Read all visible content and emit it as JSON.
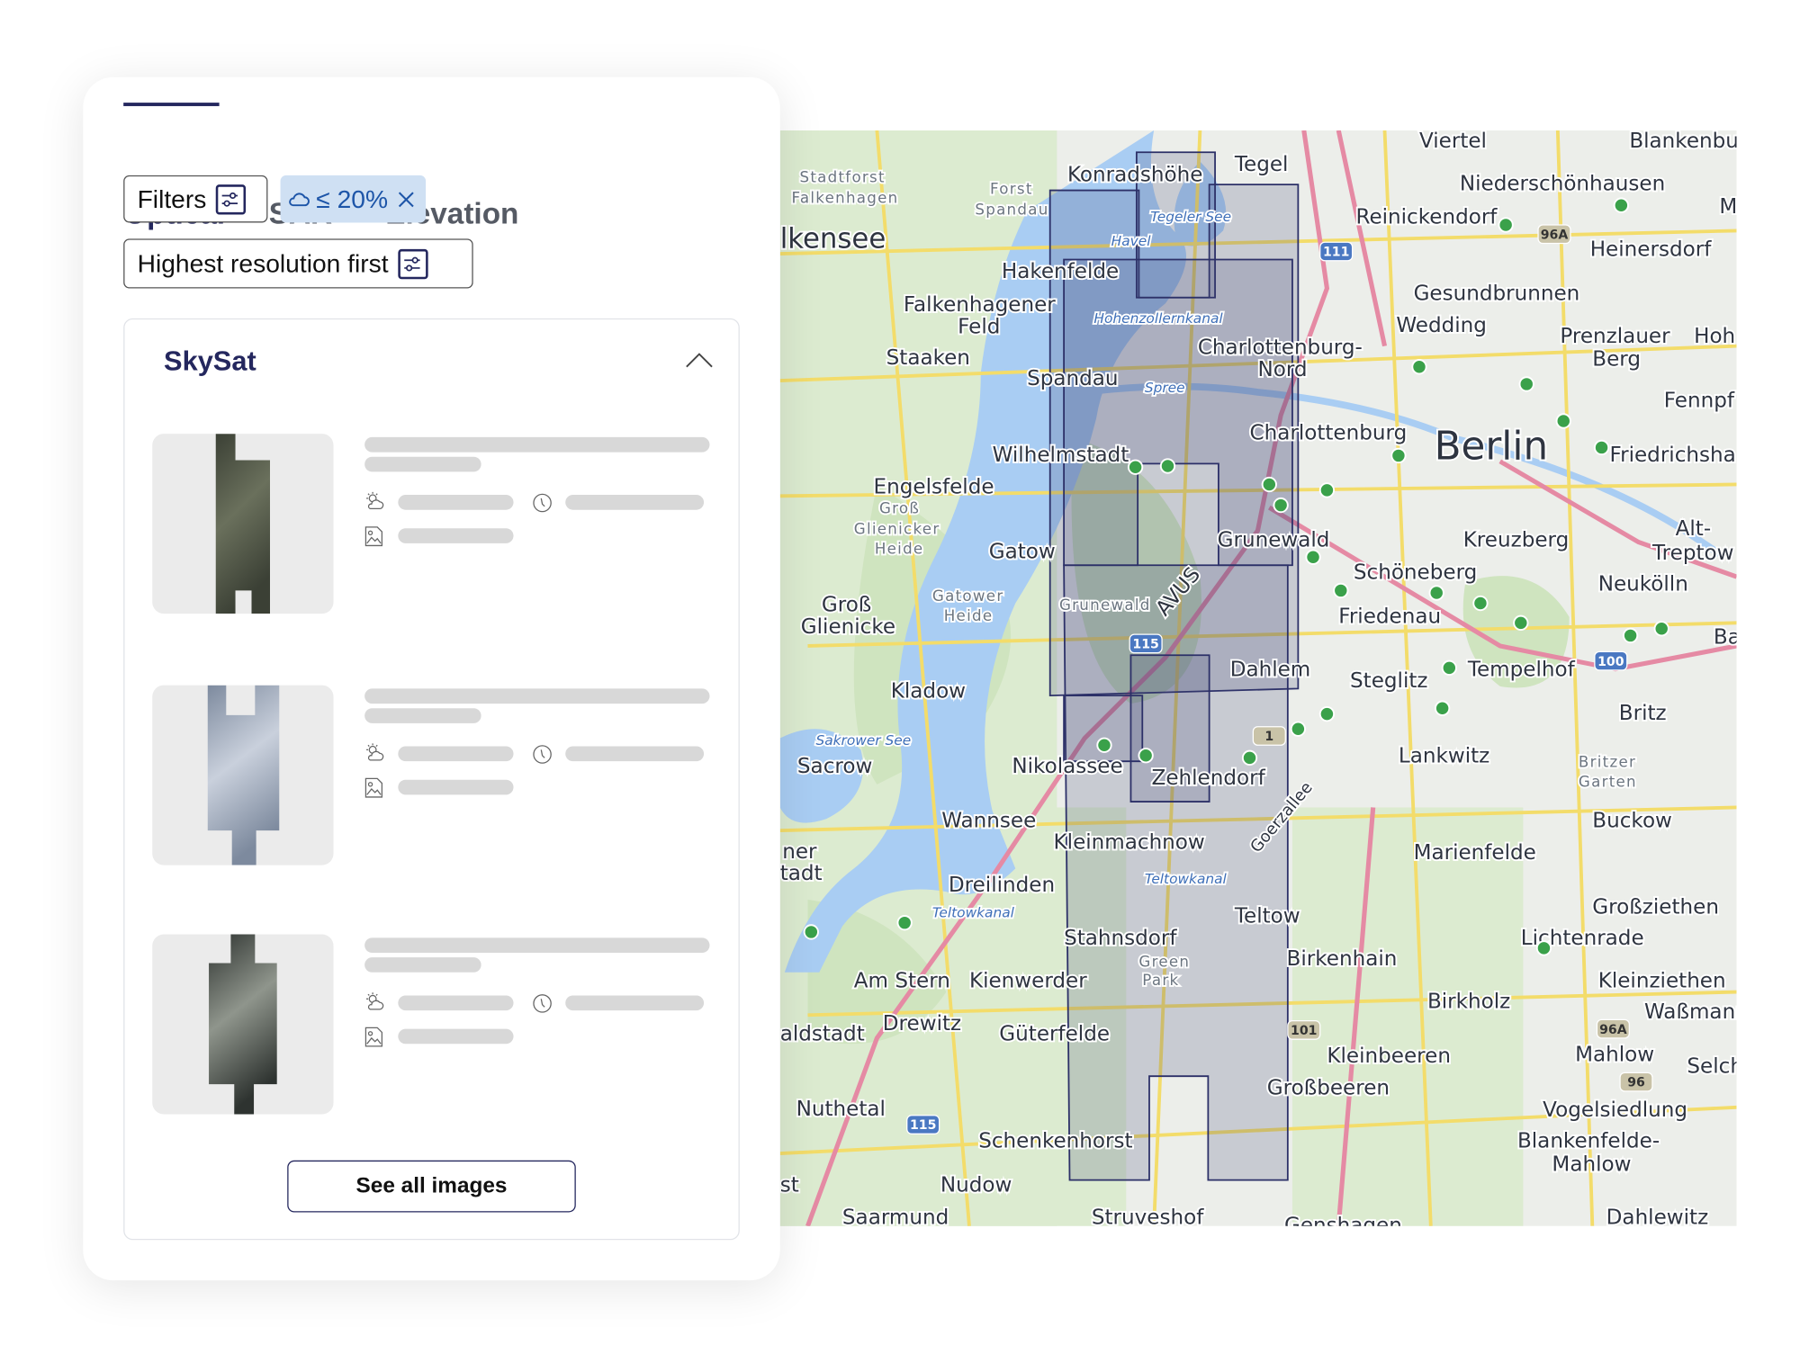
{
  "tabs": [
    {
      "label": "Optical",
      "active": true
    },
    {
      "label": "SAR",
      "active": false
    },
    {
      "label": "Elevation",
      "active": false
    }
  ],
  "filters": {
    "filters_label": "Filters",
    "chip_value": "≤ 20%",
    "chip_icon": "cloud-icon",
    "sort_label": "Highest resolution first",
    "filter_icon": "sliders-icon"
  },
  "results": {
    "group_title": "SkySat",
    "group_expanded": true,
    "items": [
      {
        "state": "loading"
      },
      {
        "state": "loading"
      },
      {
        "state": "loading"
      }
    ],
    "see_all_label": "See all images"
  },
  "colors": {
    "accent": "#24275e",
    "chip_bg": "#cfe0f3",
    "chip_text": "#1d55a8",
    "footprint_fill": "#3a3f73",
    "skeleton": "#d8d8d8"
  },
  "map": {
    "labels": [
      "Viertel",
      "Blankenbu",
      "Stadtforst",
      "Falkenhagen",
      "Forst",
      "Spandau",
      "Konradshöhe",
      "Tegel",
      "Niederschönhausen",
      "Ma",
      "lkensee",
      "Reinickendorf",
      "Heinersdorf",
      "Tegeler See",
      "Havel",
      "Hakenfelde",
      "Gesundbrunnen",
      "Falkenhagener",
      "Feld",
      "Hohenzollernkanal",
      "Wedding",
      "Prenzlauer",
      "Berg",
      "Hoh",
      "Staaken",
      "Charlottenburg-",
      "Nord",
      "Spandau",
      "Spree",
      "Fennpf",
      "Berlin",
      "Charlottenburg",
      "Friedrichsha",
      "Wilhelmstadt",
      "Engelsfelde",
      "Groß",
      "Glienicker",
      "Heide",
      "Grunewald",
      "Kreuzberg",
      "Alt-",
      "Treptow",
      "Gatow",
      "Schöneberg",
      "Neukölln",
      "Groß",
      "Glienicke",
      "Gatower",
      "Heide",
      "Grunewald",
      "Friedenau",
      "Baum",
      "Dahlem",
      "Steglitz",
      "Tempelhof",
      "Kladow",
      "Britz",
      "Sakrower See",
      "Sacrow",
      "Nikolassee",
      "Lankwitz",
      "Zehlendorf",
      "Britzer",
      "Garten",
      "Wannsee",
      "Buckow",
      "Kleinmachnow",
      "ner",
      "tadt",
      "Marienfelde",
      "Dreilinden",
      "Teltowkanal",
      "Teltowkanal",
      "Großziethen",
      "Teltow",
      "Lichtenrade",
      "Stahnsdorf",
      "Green",
      "Park",
      "Birkenhain",
      "Am Stern",
      "Kienwerder",
      "Kleinziethen",
      "Birkholz",
      "aldstadt",
      "Drewitz",
      "Güterfelde",
      "Waßmann",
      "Mahlow",
      "Kleinbeeren",
      "Selch",
      "Großbeeren",
      "Nuthetal",
      "Vogelsiedlung",
      "Blankenfelde-",
      "Mahlow",
      "Schenkenhorst",
      "st",
      "Nudow",
      "Saarmund",
      "Struveshof",
      "Genshagen",
      "Dahlewitz",
      "AVUS",
      "Goerzallee"
    ],
    "shields": [
      "111",
      "96A",
      "115",
      "1",
      "100",
      "101",
      "96A",
      "96",
      "115"
    ]
  }
}
